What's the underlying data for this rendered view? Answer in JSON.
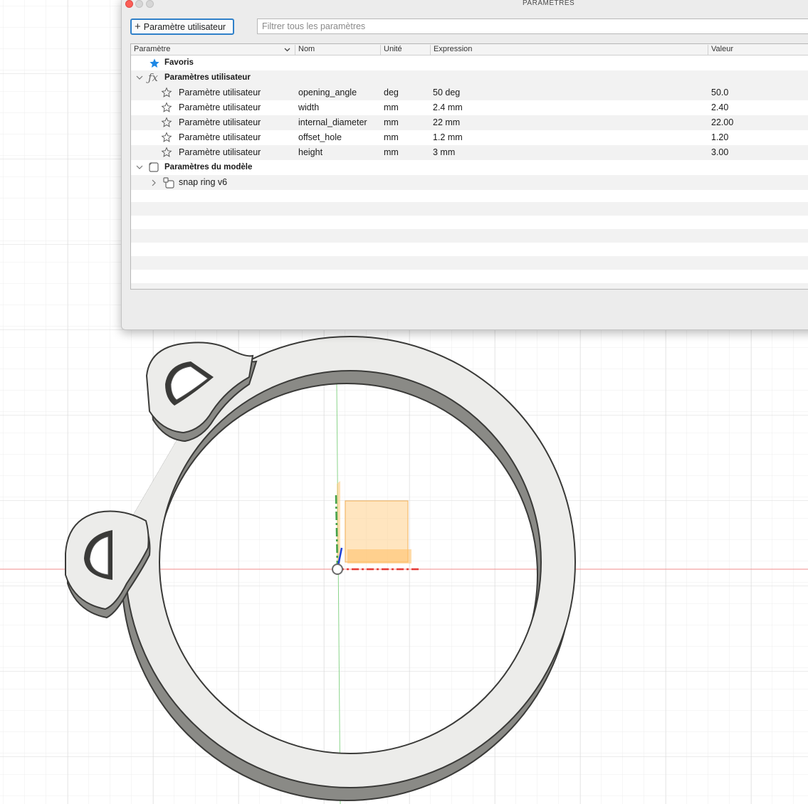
{
  "dialog": {
    "title": "PARAMÈTRES",
    "add_button_label": "Paramètre utilisateur",
    "filter_placeholder": "Filtrer tous les paramètres",
    "columns": {
      "parametre": "Paramètre",
      "nom": "Nom",
      "unite": "Unité",
      "expression": "Expression",
      "valeur": "Valeur"
    },
    "favorites_label": "Favoris",
    "user_params_group": "Paramètres utilisateur",
    "user_params": [
      {
        "type": "Paramètre utilisateur",
        "name": "opening_angle",
        "unit": "deg",
        "expression": "50 deg",
        "value": "50.0"
      },
      {
        "type": "Paramètre utilisateur",
        "name": "width",
        "unit": "mm",
        "expression": "2.4 mm",
        "value": "2.40"
      },
      {
        "type": "Paramètre utilisateur",
        "name": "internal_diameter",
        "unit": "mm",
        "expression": "22 mm",
        "value": "22.00"
      },
      {
        "type": "Paramètre utilisateur",
        "name": "offset_hole",
        "unit": "mm",
        "expression": "1.2 mm",
        "value": "1.20"
      },
      {
        "type": "Paramètre utilisateur",
        "name": "height",
        "unit": "mm",
        "expression": "3 mm",
        "value": "3.00"
      }
    ],
    "model_params_group": "Paramètres du modèle",
    "model_component": "snap ring v6"
  },
  "colors": {
    "accent": "#2f80c9",
    "favorite_star": "#1e88e5",
    "axis_x": "#e53935",
    "axis_y": "#43a047",
    "axis_z": "#1e40d8",
    "ring_face": "#ececea",
    "ring_side": "#8a8a86"
  },
  "icons": {
    "favorite": "star-filled-icon",
    "row_favorite": "star-outline-icon",
    "user_group": "function-fx-icon",
    "model_group": "cube-icon",
    "component": "component-icon",
    "plus": "plus-icon"
  }
}
